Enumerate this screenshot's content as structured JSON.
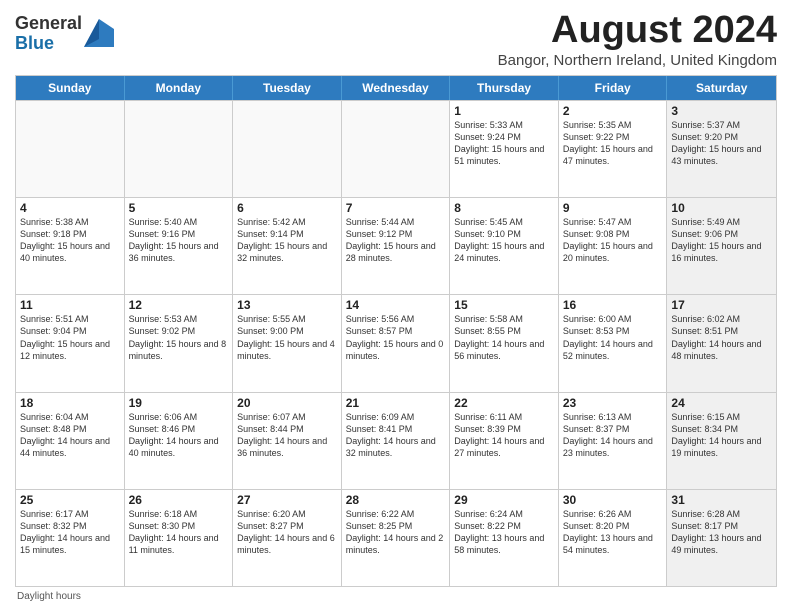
{
  "header": {
    "logo_general": "General",
    "logo_blue": "Blue",
    "month_title": "August 2024",
    "subtitle": "Bangor, Northern Ireland, United Kingdom"
  },
  "days_of_week": [
    "Sunday",
    "Monday",
    "Tuesday",
    "Wednesday",
    "Thursday",
    "Friday",
    "Saturday"
  ],
  "weeks": [
    [
      {
        "day": "",
        "empty": true
      },
      {
        "day": "",
        "empty": true
      },
      {
        "day": "",
        "empty": true
      },
      {
        "day": "",
        "empty": true
      },
      {
        "day": "1",
        "sunrise": "Sunrise: 5:33 AM",
        "sunset": "Sunset: 9:24 PM",
        "daylight": "Daylight: 15 hours and 51 minutes."
      },
      {
        "day": "2",
        "sunrise": "Sunrise: 5:35 AM",
        "sunset": "Sunset: 9:22 PM",
        "daylight": "Daylight: 15 hours and 47 minutes."
      },
      {
        "day": "3",
        "sunrise": "Sunrise: 5:37 AM",
        "sunset": "Sunset: 9:20 PM",
        "daylight": "Daylight: 15 hours and 43 minutes.",
        "shaded": true
      }
    ],
    [
      {
        "day": "4",
        "sunrise": "Sunrise: 5:38 AM",
        "sunset": "Sunset: 9:18 PM",
        "daylight": "Daylight: 15 hours and 40 minutes."
      },
      {
        "day": "5",
        "sunrise": "Sunrise: 5:40 AM",
        "sunset": "Sunset: 9:16 PM",
        "daylight": "Daylight: 15 hours and 36 minutes."
      },
      {
        "day": "6",
        "sunrise": "Sunrise: 5:42 AM",
        "sunset": "Sunset: 9:14 PM",
        "daylight": "Daylight: 15 hours and 32 minutes."
      },
      {
        "day": "7",
        "sunrise": "Sunrise: 5:44 AM",
        "sunset": "Sunset: 9:12 PM",
        "daylight": "Daylight: 15 hours and 28 minutes."
      },
      {
        "day": "8",
        "sunrise": "Sunrise: 5:45 AM",
        "sunset": "Sunset: 9:10 PM",
        "daylight": "Daylight: 15 hours and 24 minutes."
      },
      {
        "day": "9",
        "sunrise": "Sunrise: 5:47 AM",
        "sunset": "Sunset: 9:08 PM",
        "daylight": "Daylight: 15 hours and 20 minutes."
      },
      {
        "day": "10",
        "sunrise": "Sunrise: 5:49 AM",
        "sunset": "Sunset: 9:06 PM",
        "daylight": "Daylight: 15 hours and 16 minutes.",
        "shaded": true
      }
    ],
    [
      {
        "day": "11",
        "sunrise": "Sunrise: 5:51 AM",
        "sunset": "Sunset: 9:04 PM",
        "daylight": "Daylight: 15 hours and 12 minutes."
      },
      {
        "day": "12",
        "sunrise": "Sunrise: 5:53 AM",
        "sunset": "Sunset: 9:02 PM",
        "daylight": "Daylight: 15 hours and 8 minutes."
      },
      {
        "day": "13",
        "sunrise": "Sunrise: 5:55 AM",
        "sunset": "Sunset: 9:00 PM",
        "daylight": "Daylight: 15 hours and 4 minutes."
      },
      {
        "day": "14",
        "sunrise": "Sunrise: 5:56 AM",
        "sunset": "Sunset: 8:57 PM",
        "daylight": "Daylight: 15 hours and 0 minutes."
      },
      {
        "day": "15",
        "sunrise": "Sunrise: 5:58 AM",
        "sunset": "Sunset: 8:55 PM",
        "daylight": "Daylight: 14 hours and 56 minutes."
      },
      {
        "day": "16",
        "sunrise": "Sunrise: 6:00 AM",
        "sunset": "Sunset: 8:53 PM",
        "daylight": "Daylight: 14 hours and 52 minutes."
      },
      {
        "day": "17",
        "sunrise": "Sunrise: 6:02 AM",
        "sunset": "Sunset: 8:51 PM",
        "daylight": "Daylight: 14 hours and 48 minutes.",
        "shaded": true
      }
    ],
    [
      {
        "day": "18",
        "sunrise": "Sunrise: 6:04 AM",
        "sunset": "Sunset: 8:48 PM",
        "daylight": "Daylight: 14 hours and 44 minutes."
      },
      {
        "day": "19",
        "sunrise": "Sunrise: 6:06 AM",
        "sunset": "Sunset: 8:46 PM",
        "daylight": "Daylight: 14 hours and 40 minutes."
      },
      {
        "day": "20",
        "sunrise": "Sunrise: 6:07 AM",
        "sunset": "Sunset: 8:44 PM",
        "daylight": "Daylight: 14 hours and 36 minutes."
      },
      {
        "day": "21",
        "sunrise": "Sunrise: 6:09 AM",
        "sunset": "Sunset: 8:41 PM",
        "daylight": "Daylight: 14 hours and 32 minutes."
      },
      {
        "day": "22",
        "sunrise": "Sunrise: 6:11 AM",
        "sunset": "Sunset: 8:39 PM",
        "daylight": "Daylight: 14 hours and 27 minutes."
      },
      {
        "day": "23",
        "sunrise": "Sunrise: 6:13 AM",
        "sunset": "Sunset: 8:37 PM",
        "daylight": "Daylight: 14 hours and 23 minutes."
      },
      {
        "day": "24",
        "sunrise": "Sunrise: 6:15 AM",
        "sunset": "Sunset: 8:34 PM",
        "daylight": "Daylight: 14 hours and 19 minutes.",
        "shaded": true
      }
    ],
    [
      {
        "day": "25",
        "sunrise": "Sunrise: 6:17 AM",
        "sunset": "Sunset: 8:32 PM",
        "daylight": "Daylight: 14 hours and 15 minutes."
      },
      {
        "day": "26",
        "sunrise": "Sunrise: 6:18 AM",
        "sunset": "Sunset: 8:30 PM",
        "daylight": "Daylight: 14 hours and 11 minutes."
      },
      {
        "day": "27",
        "sunrise": "Sunrise: 6:20 AM",
        "sunset": "Sunset: 8:27 PM",
        "daylight": "Daylight: 14 hours and 6 minutes."
      },
      {
        "day": "28",
        "sunrise": "Sunrise: 6:22 AM",
        "sunset": "Sunset: 8:25 PM",
        "daylight": "Daylight: 14 hours and 2 minutes."
      },
      {
        "day": "29",
        "sunrise": "Sunrise: 6:24 AM",
        "sunset": "Sunset: 8:22 PM",
        "daylight": "Daylight: 13 hours and 58 minutes."
      },
      {
        "day": "30",
        "sunrise": "Sunrise: 6:26 AM",
        "sunset": "Sunset: 8:20 PM",
        "daylight": "Daylight: 13 hours and 54 minutes."
      },
      {
        "day": "31",
        "sunrise": "Sunrise: 6:28 AM",
        "sunset": "Sunset: 8:17 PM",
        "daylight": "Daylight: 13 hours and 49 minutes.",
        "shaded": true
      }
    ]
  ],
  "footer": {
    "note": "Daylight hours"
  }
}
